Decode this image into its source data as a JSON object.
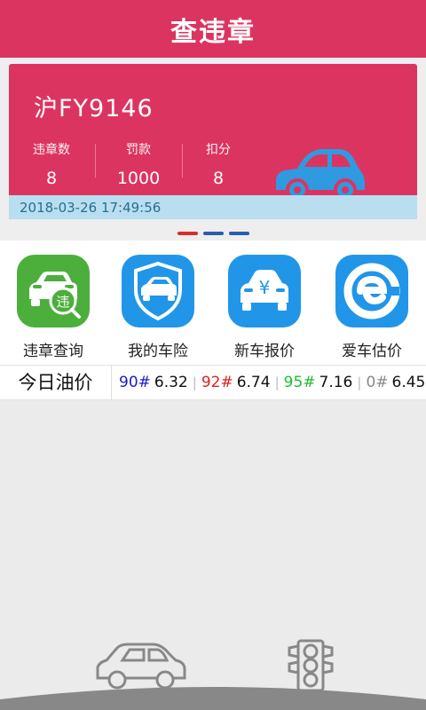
{
  "header": {
    "title": "查违章"
  },
  "card": {
    "plate": "沪FY9146",
    "stats": [
      {
        "label": "违章数",
        "value": "8"
      },
      {
        "label": "罚款",
        "value": "1000"
      },
      {
        "label": "扣分",
        "value": "8"
      }
    ],
    "timestamp": "2018-03-26 17:49:56",
    "car_icon": "car-icon"
  },
  "pager": {
    "dots": [
      "#dd2b2b",
      "#2a5db0",
      "#2a5db0"
    ]
  },
  "quick_actions": [
    {
      "label": "违章查询",
      "icon": "violation-car-icon",
      "color": "#4caf3c"
    },
    {
      "label": "我的车险",
      "icon": "insurance-shield-car-icon",
      "color": "#2196e8"
    },
    {
      "label": "新车报价",
      "icon": "price-car-icon",
      "color": "#2196e8"
    },
    {
      "label": "爱车估价",
      "icon": "evaluation-e-icon",
      "color": "#2196e8"
    }
  ],
  "oil_prices": {
    "title": "今日油价",
    "items": [
      {
        "grade": "90#",
        "price": "6.32",
        "color": "#1a1acc"
      },
      {
        "grade": "92#",
        "price": "6.74",
        "color": "#e02020"
      },
      {
        "grade": "95#",
        "price": "7.16",
        "color": "#22bb33"
      },
      {
        "grade": "0#",
        "price": "6.45",
        "color": "#888888"
      }
    ]
  },
  "colors": {
    "primary": "#dc3460",
    "time_bg": "#b8def0"
  }
}
